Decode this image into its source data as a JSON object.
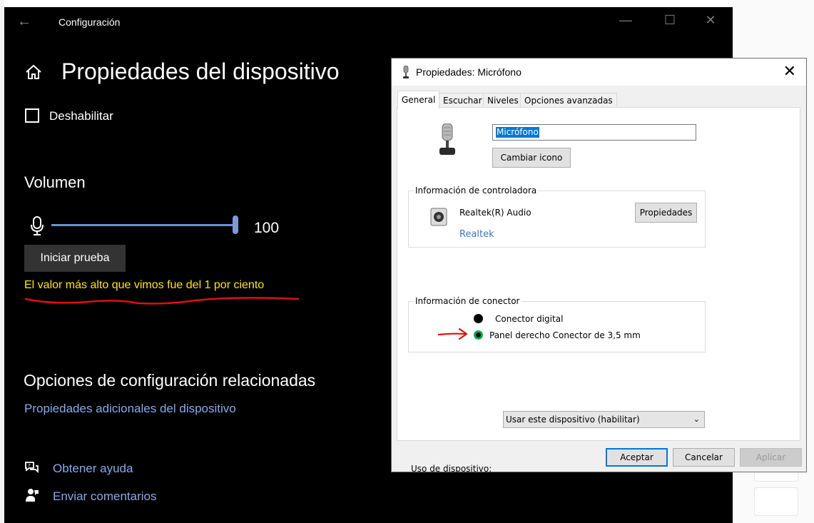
{
  "settings": {
    "app_title": "Configuración",
    "page_title": "Propiedades del dispositivo",
    "disable_label": "Deshabilitar",
    "volume_title": "Volumen",
    "volume_value": "100",
    "volume_level": 100,
    "test_button": "Iniciar prueba",
    "peak_message": "El valor más alto que vimos fue del 1 por ciento",
    "related_title": "Opciones de configuración relacionadas",
    "additional_link": "Propiedades adicionales del dispositivo",
    "help_link": "Obtener ayuda",
    "feedback_link": "Enviar comentarios"
  },
  "dialog": {
    "title": "Propiedades: Micrófono",
    "tabs": [
      {
        "label": "General"
      },
      {
        "label": "Escuchar"
      },
      {
        "label": "Niveles"
      },
      {
        "label": "Opciones avanzadas"
      }
    ],
    "device_name": "Micrófono",
    "change_icon_button": "Cambiar icono",
    "controller_group": "Información de controladora",
    "controller_name": "Realtek(R) Audio",
    "controller_vendor": "Realtek",
    "properties_button": "Propiedades",
    "connector_group": "Información de conector",
    "connector_digital": "Conector digital",
    "connector_panel": "Panel derecho Conector de 3,5 mm",
    "device_usage_label": "Uso de dispositivo:",
    "device_usage_value": "Usar este dispositivo (habilitar)",
    "ok_button": "Aceptar",
    "cancel_button": "Cancelar",
    "apply_button": "Aplicar"
  },
  "colors": {
    "settings_bg": "#000000",
    "accent_link": "#87a9ef",
    "peak_text": "#ffe600",
    "annotation_red": "#e01010",
    "dialog_bg": "#f0f0f0",
    "selection": "#0078d7",
    "jack_green": "#00b050"
  }
}
